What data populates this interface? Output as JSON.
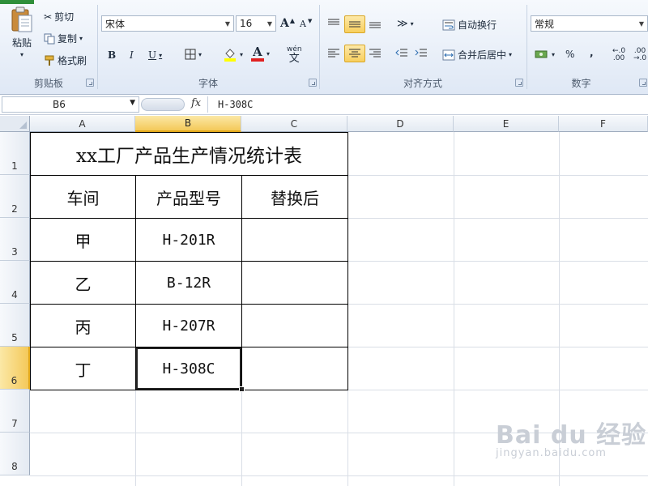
{
  "ribbon": {
    "clipboard": {
      "paste": "粘贴",
      "cut": "剪切",
      "copy": "复制",
      "format_painter": "格式刷",
      "group_label": "剪贴板"
    },
    "font": {
      "font_name": "宋体",
      "font_size": "16",
      "group_label": "字体",
      "bold": "B",
      "italic": "I",
      "underline": "U",
      "grow": "A",
      "shrink": "A",
      "font_color_glyph": "A",
      "phonetic": "wén"
    },
    "alignment": {
      "wrap_text": "自动换行",
      "merge_center": "合并后居中",
      "group_label": "对齐方式"
    },
    "number": {
      "format": "常规",
      "group_label": "数字",
      "percent": "%",
      "comma": ",",
      "inc_decimal": "←.0 .00",
      "dec_decimal": ".00 →.0"
    }
  },
  "formula_bar": {
    "name_box": "B6",
    "fx": "fx",
    "value": "H-308C"
  },
  "columns": [
    "A",
    "B",
    "C",
    "D",
    "E",
    "F"
  ],
  "rows": [
    "1",
    "2",
    "3",
    "4",
    "5",
    "6",
    "7",
    "8"
  ],
  "selected": {
    "column": "B",
    "row": "6"
  },
  "table": {
    "title": "xx工厂产品生产情况统计表",
    "headers": [
      "车间",
      "产品型号",
      "替换后"
    ],
    "rows": [
      [
        "甲",
        "H-201R",
        ""
      ],
      [
        "乙",
        "B-12R",
        ""
      ],
      [
        "丙",
        "H-207R",
        ""
      ],
      [
        "丁",
        "H-308C",
        ""
      ]
    ]
  },
  "watermark": {
    "brand": "Bai du 经验",
    "url": "jingyan.baidu.com"
  },
  "colors": {
    "selection": "#f4c95a",
    "ribbon_bg": "#dfe8f5"
  }
}
